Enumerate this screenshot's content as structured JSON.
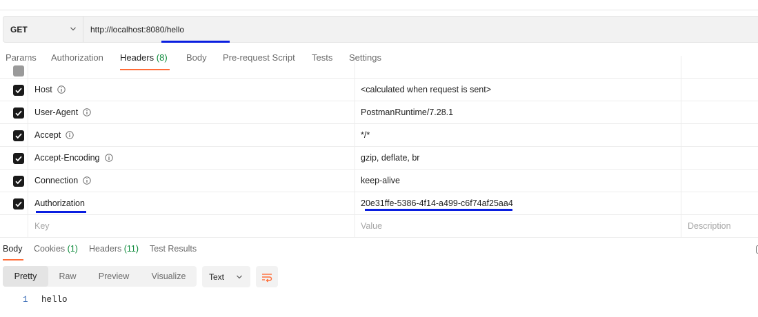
{
  "request": {
    "method": "GET",
    "url": "http://localhost:8080/hello"
  },
  "request_tabs": [
    {
      "label": "Params",
      "count": ""
    },
    {
      "label": "Authorization",
      "count": ""
    },
    {
      "label": "Headers",
      "count": "(8)"
    },
    {
      "label": "Body",
      "count": ""
    },
    {
      "label": "Pre-request Script",
      "count": ""
    },
    {
      "label": "Tests",
      "count": ""
    },
    {
      "label": "Settings",
      "count": ""
    }
  ],
  "active_request_tab": "Headers",
  "headers": [
    {
      "key": "Host",
      "value": "<calculated when request is sent>",
      "checked": true,
      "info": true
    },
    {
      "key": "User-Agent",
      "value": "PostmanRuntime/7.28.1",
      "checked": true,
      "info": true
    },
    {
      "key": "Accept",
      "value": "*/*",
      "checked": true,
      "info": true
    },
    {
      "key": "Accept-Encoding",
      "value": "gzip, deflate, br",
      "checked": true,
      "info": true
    },
    {
      "key": "Connection",
      "value": "keep-alive",
      "checked": true,
      "info": true
    },
    {
      "key": "Authorization",
      "value": "20e31ffe-5386-4f14-a499-c6f74af25aa4",
      "checked": true,
      "info": false
    }
  ],
  "new_row": {
    "key_placeholder": "Key",
    "value_placeholder": "Value",
    "description_placeholder": "Description"
  },
  "response_tabs": [
    {
      "label": "Body",
      "count": ""
    },
    {
      "label": "Cookies",
      "count": "(1)"
    },
    {
      "label": "Headers",
      "count": "(11)"
    },
    {
      "label": "Test Results",
      "count": ""
    }
  ],
  "active_response_tab": "Body",
  "view_modes": [
    "Pretty",
    "Raw",
    "Preview",
    "Visualize"
  ],
  "active_view_mode": "Pretty",
  "format": "Text",
  "response_body": [
    {
      "line": "1",
      "text": "hello"
    }
  ],
  "colors": {
    "accent_orange": "#ff6c37",
    "count_green": "#0c8a3a",
    "highlight_blue": "#0a1ee0"
  },
  "icons": [
    "chevron-down-icon",
    "info-icon",
    "checkbox-checked-icon",
    "wrap-lines-icon"
  ]
}
